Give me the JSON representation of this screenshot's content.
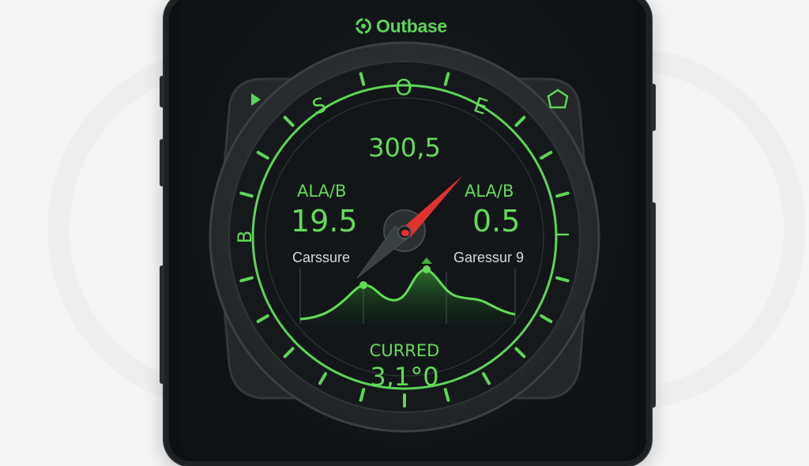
{
  "brand": {
    "name": "Outbase"
  },
  "compass": {
    "letters": [
      "S",
      "O",
      "E",
      "B",
      "L"
    ],
    "heading_value": "300,5",
    "needle_colors": {
      "north": "#e0322e",
      "south": "#3a3f42"
    }
  },
  "left_panel": {
    "label": "ALA/B",
    "value": "19.5",
    "caption": "Carssure"
  },
  "right_panel": {
    "label": "ALA/B",
    "value": "0.5",
    "caption": "Garessur 9"
  },
  "bottom": {
    "label": "CURRED",
    "value": "3,1°0"
  },
  "corner_icons": {
    "left": "play-triangle-icon",
    "right": "home-pentagon-icon"
  },
  "colors": {
    "accent": "#5fd35a",
    "bezel": "#2a2e30",
    "face": "#121618"
  }
}
